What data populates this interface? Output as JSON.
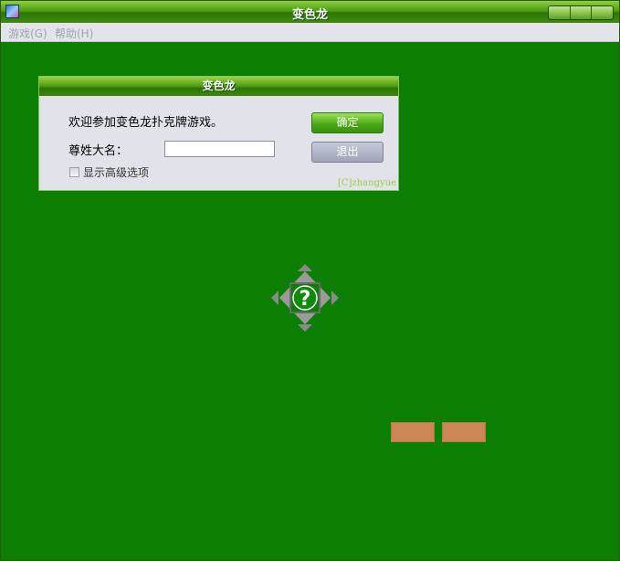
{
  "window": {
    "title": "变色龙"
  },
  "menu": [
    {
      "label": "游戏(G)"
    },
    {
      "label": "帮助(H)"
    }
  ],
  "dialog": {
    "title": "变色龙",
    "welcome": "欢迎参加变色龙扑克牌游戏。",
    "name_label": "尊姓大名：",
    "name_value": "",
    "advanced_label": "显示高级选项",
    "ok_label": "确定",
    "exit_label": "退出",
    "copyright": "[C]zhangyue"
  },
  "center_icon": {
    "symbol": "?",
    "icon": "question-mark-icon"
  },
  "colors": {
    "felt": "#0b7e03",
    "accent": "#4b9a10",
    "tile": "#cd8655"
  }
}
